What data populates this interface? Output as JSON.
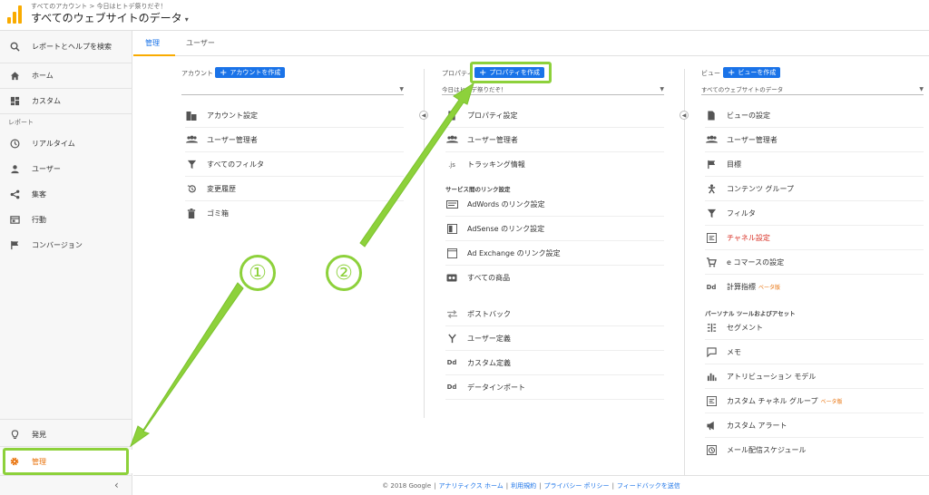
{
  "header": {
    "breadcrumb": "すべてのアカウント > 今日はヒトデ祭りだぞ！",
    "view_title": "すべてのウェブサイトのデータ",
    "caret": "▾"
  },
  "sidebar": {
    "search": "レポートとヘルプを検索",
    "home": "ホーム",
    "custom": "カスタム",
    "reports_section": "レポート",
    "realtime": "リアルタイム",
    "users": "ユーザー",
    "acquisition": "集客",
    "behavior": "行動",
    "conversions": "コンバージョン",
    "discover": "発見",
    "admin": "管理",
    "collapse": "‹"
  },
  "tabs": [
    {
      "label": "管理"
    },
    {
      "label": "ユーザー"
    }
  ],
  "account": {
    "heading": "アカウント",
    "create_button": "アカウントを作成",
    "selected": "",
    "items": [
      {
        "label": "アカウント設定"
      },
      {
        "label": "ユーザー管理者"
      },
      {
        "label": "すべてのフィルタ"
      },
      {
        "label": "変更履歴"
      },
      {
        "label": "ゴミ箱"
      }
    ]
  },
  "property": {
    "heading": "プロパティ",
    "create_button": "プロパティを作成",
    "selected": "今日はヒトデ祭りだぞ！",
    "items": [
      {
        "label": "プロパティ設定"
      },
      {
        "label": "ユーザー管理者"
      },
      {
        "label": "トラッキング情報"
      }
    ],
    "product_links_heading": "サービス間のリンク設定",
    "product_links": [
      {
        "label": "AdWords のリンク設定"
      },
      {
        "label": "AdSense のリンク設定"
      },
      {
        "label": "Ad Exchange のリンク設定"
      },
      {
        "label": "すべての商品"
      }
    ],
    "more_items": [
      {
        "label": "ポストバック"
      },
      {
        "label": "ユーザー定義"
      },
      {
        "label": "カスタム定義"
      },
      {
        "label": "データインポート"
      }
    ]
  },
  "view": {
    "heading": "ビュー",
    "create_button": "ビューを作成",
    "selected": "すべてのウェブサイトのデータ",
    "items": [
      {
        "label": "ビューの設定"
      },
      {
        "label": "ユーザー管理者"
      },
      {
        "label": "目標"
      },
      {
        "label": "コンテンツ グループ"
      },
      {
        "label": "フィルタ"
      },
      {
        "label": "チャネル設定"
      },
      {
        "label": "e コマースの設定"
      },
      {
        "label": "計算指標"
      }
    ],
    "beta_label": "ベータ版",
    "personal_heading": "パーソナル ツールおよびアセット",
    "personal_items": [
      {
        "label": "セグメント"
      },
      {
        "label": "メモ"
      },
      {
        "label": "アトリビューション モデル"
      },
      {
        "label": "カスタム チャネル グループ"
      },
      {
        "label": "カスタム アラート"
      },
      {
        "label": "メール配信スケジュール"
      }
    ]
  },
  "footer": {
    "copyright": "© 2018 Google",
    "links": [
      "アナリティクス ホーム",
      "利用規約",
      "プライバシー ポリシー",
      "フィードバックを送信"
    ],
    "separator": "|"
  },
  "annotations": {
    "step1": "①",
    "step2": "②",
    "color": "#8dd13b"
  },
  "colors": {
    "accent_blue": "#1a73e8",
    "accent_orange": "#e8710a",
    "logo_yellow": "#f9ab00",
    "active_red": "#d93025"
  }
}
